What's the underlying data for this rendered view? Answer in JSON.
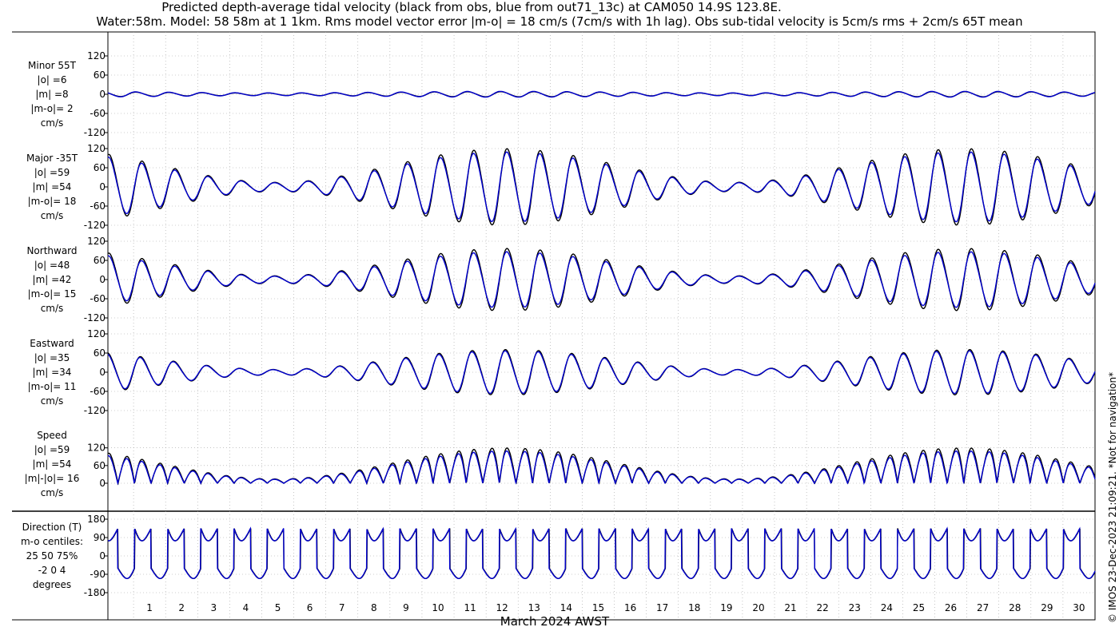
{
  "title_line1": "Predicted depth-average tidal velocity (black from obs, blue from out71_13c) at CAM050 14.9S 123.8E.",
  "title_line2": "Water:58m. Model: 58 58m at 1 1km. Rms model vector error |m-o| = 18 cm/s (7cm/s with 1h lag). Obs sub-tidal velocity is 5cm/s rms + 2cm/s 65T mean",
  "watermark": "© IMOS 23-Dec-2023 21:09:21. *Not for navigation*",
  "colors": {
    "obs": "#000000",
    "model": "#0000d0",
    "grid": "#a0a0a0"
  },
  "chart_data": {
    "type": "line",
    "xlabel": "March 2024 AWST",
    "x_ticks": [
      "1",
      "2",
      "3",
      "4",
      "5",
      "6",
      "7",
      "8",
      "9",
      "10",
      "11",
      "12",
      "13",
      "14",
      "15",
      "16",
      "17",
      "18",
      "19",
      "20",
      "21",
      "22",
      "23",
      "24",
      "25",
      "26",
      "27",
      "28",
      "29",
      "30"
    ],
    "x_range_days": [
      0.2,
      31.0
    ],
    "series": [
      {
        "name": "obs",
        "color": "#000000"
      },
      {
        "name": "model",
        "color": "#0000d0"
      }
    ],
    "panels": [
      {
        "key": "minor",
        "label_lines": [
          "Minor 55T",
          "|o| =6",
          "|m| =8",
          "|m-o|= 2",
          "cm/s"
        ],
        "yticks": [
          "120",
          "60",
          "0",
          "-60",
          "-120"
        ],
        "ylim": [
          -120,
          120
        ],
        "kind": "minor",
        "amp_obs": 8,
        "amp_model": 9
      },
      {
        "key": "major",
        "label_lines": [
          "Major -35T",
          "|o| =59",
          "|m| =54",
          "|m-o|= 18",
          "cm/s"
        ],
        "yticks": [
          "120",
          "60",
          "0",
          "-60",
          "-120"
        ],
        "ylim": [
          -120,
          120
        ],
        "kind": "major",
        "amp_obs": 118,
        "amp_model": 108
      },
      {
        "key": "north",
        "label_lines": [
          "Northward",
          "|o| =48",
          "|m| =42",
          "|m-o|= 15",
          "cm/s"
        ],
        "yticks": [
          "120",
          "60",
          "0",
          "-60",
          "-120"
        ],
        "ylim": [
          -120,
          120
        ],
        "kind": "north",
        "amp_obs": 96,
        "amp_model": 86
      },
      {
        "key": "east",
        "label_lines": [
          "Eastward",
          "|o| =35",
          "|m| =34",
          "|m-o|= 11",
          "cm/s"
        ],
        "yticks": [
          "120",
          "60",
          "0",
          "-60",
          "-120"
        ],
        "ylim": [
          -120,
          120
        ],
        "kind": "east",
        "amp_obs": 70,
        "amp_model": 66
      },
      {
        "key": "speed",
        "label_lines": [
          "Speed",
          "|o| =59",
          "|m| =54",
          "|m|-|o|= 16",
          "cm/s"
        ],
        "yticks": [
          "120",
          "60",
          "0"
        ],
        "ylim": [
          0,
          130
        ],
        "kind": "speed",
        "amp_obs": 118,
        "amp_model": 108
      },
      {
        "key": "dir",
        "label_lines": [
          "Direction (T)",
          "m-o centiles:",
          "25  50  75%",
          "-2  0  4",
          "degrees"
        ],
        "yticks": [
          "180",
          "90",
          "0",
          "-90",
          "-180"
        ],
        "ylim": [
          -180,
          180
        ],
        "kind": "dir",
        "amp_obs": 180,
        "amp_model": 180
      }
    ]
  }
}
